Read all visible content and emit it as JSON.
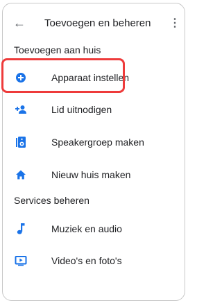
{
  "header": {
    "back_icon": "arrow-back-icon",
    "title": "Toevoegen en beheren",
    "more_icon": "more-vert-icon"
  },
  "sections": [
    {
      "title": "Toevoegen aan huis",
      "items": [
        {
          "label": "Apparaat instellen",
          "icon": "add-circle-icon"
        },
        {
          "label": "Lid uitnodigen",
          "icon": "person-add-icon"
        },
        {
          "label": "Speakergroep maken",
          "icon": "speaker-group-icon"
        },
        {
          "label": "Nieuw huis maken",
          "icon": "home-icon"
        }
      ]
    },
    {
      "title": "Services beheren",
      "items": [
        {
          "label": "Muziek en audio",
          "icon": "music-note-icon"
        },
        {
          "label": "Video's en foto's",
          "icon": "video-tv-icon"
        }
      ]
    }
  ],
  "colors": {
    "accent": "#1a73e8",
    "highlight": "#ee3b3b",
    "text": "#202124",
    "icon_gray": "#5f6368"
  }
}
